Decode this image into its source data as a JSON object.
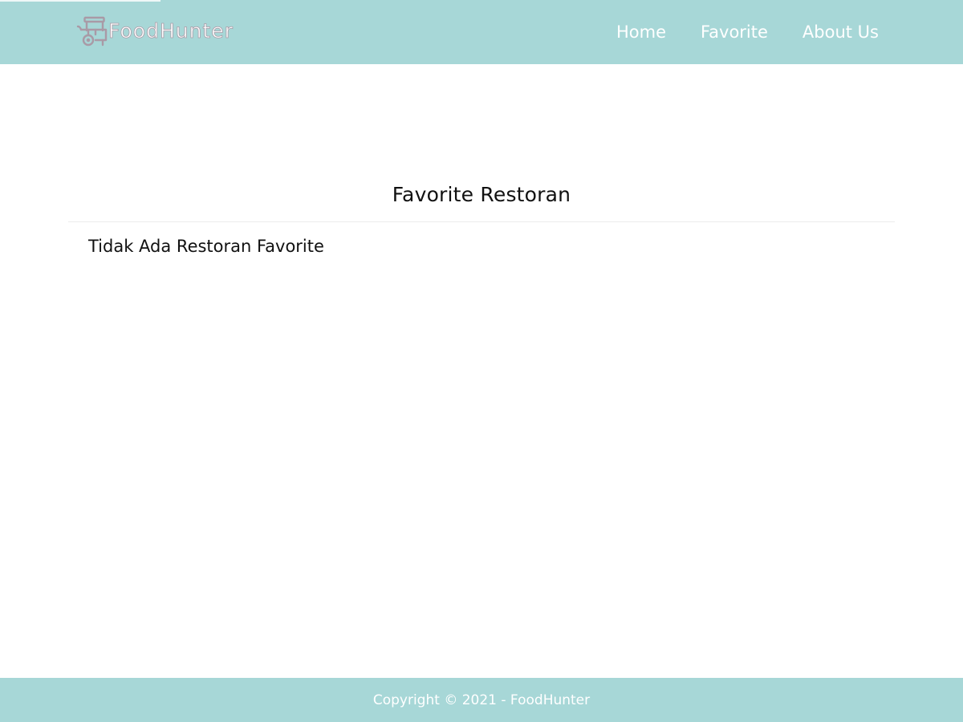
{
  "brand": {
    "name": "FoodHunter",
    "icon": "food-cart-icon"
  },
  "navigation": {
    "items": [
      {
        "label": "Home"
      },
      {
        "label": "Favorite"
      },
      {
        "label": "About Us"
      }
    ]
  },
  "main": {
    "title": "Favorite Restoran",
    "empty_message": "Tidak Ada Restoran Favorite"
  },
  "footer": {
    "text": "Copyright © 2021 - FoodHunter"
  },
  "colors": {
    "header_background": "#a7d7d7",
    "footer_background": "#a7d7d7",
    "nav_text": "#ffffff",
    "logo_icon": "#a99aa6",
    "body_background": "#ffffff",
    "divider": "#ececec"
  }
}
